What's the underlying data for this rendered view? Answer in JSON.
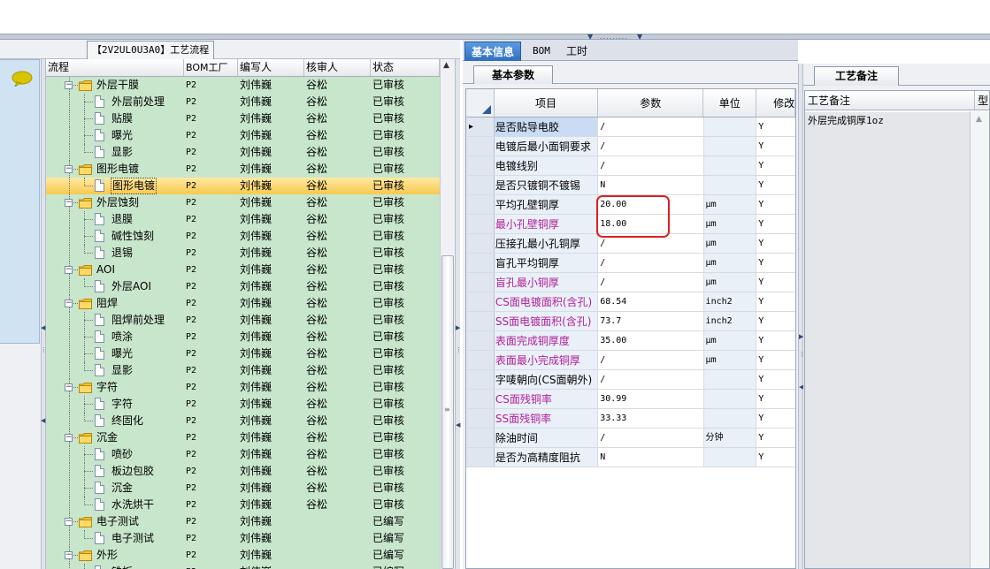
{
  "left": {
    "doc_tab": "【2V2UL0U3A0】工艺流程",
    "columns": [
      "流程",
      "BOM工厂",
      "编写人",
      "核审人",
      "状态"
    ],
    "rows": [
      {
        "level": 0,
        "type": "folder",
        "name": "外层干膜",
        "bom": "P2",
        "author": "刘伟巍",
        "reviewer": "谷松",
        "status": "已审核"
      },
      {
        "level": 1,
        "type": "page",
        "name": "外层前处理",
        "bom": "P2",
        "author": "刘伟巍",
        "reviewer": "谷松",
        "status": "已审核"
      },
      {
        "level": 1,
        "type": "page",
        "name": "贴膜",
        "bom": "P2",
        "author": "刘伟巍",
        "reviewer": "谷松",
        "status": "已审核"
      },
      {
        "level": 1,
        "type": "page",
        "name": "曝光",
        "bom": "P2",
        "author": "刘伟巍",
        "reviewer": "谷松",
        "status": "已审核"
      },
      {
        "level": 1,
        "type": "page",
        "name": "显影",
        "bom": "P2",
        "author": "刘伟巍",
        "reviewer": "谷松",
        "status": "已审核"
      },
      {
        "level": 0,
        "type": "folder",
        "name": "图形电镀",
        "bom": "P2",
        "author": "刘伟巍",
        "reviewer": "谷松",
        "status": "已审核"
      },
      {
        "level": 1,
        "type": "page",
        "name": "图形电镀",
        "bom": "P2",
        "author": "刘伟巍",
        "reviewer": "谷松",
        "status": "已审核",
        "selected": true
      },
      {
        "level": 0,
        "type": "folder",
        "name": "外层蚀刻",
        "bom": "P2",
        "author": "刘伟巍",
        "reviewer": "谷松",
        "status": "已审核"
      },
      {
        "level": 1,
        "type": "page",
        "name": "退膜",
        "bom": "P2",
        "author": "刘伟巍",
        "reviewer": "谷松",
        "status": "已审核"
      },
      {
        "level": 1,
        "type": "page",
        "name": "碱性蚀刻",
        "bom": "P2",
        "author": "刘伟巍",
        "reviewer": "谷松",
        "status": "已审核"
      },
      {
        "level": 1,
        "type": "page",
        "name": "退锡",
        "bom": "P2",
        "author": "刘伟巍",
        "reviewer": "谷松",
        "status": "已审核"
      },
      {
        "level": 0,
        "type": "folder",
        "name": "AOI",
        "bom": "P2",
        "author": "刘伟巍",
        "reviewer": "谷松",
        "status": "已审核"
      },
      {
        "level": 1,
        "type": "page",
        "name": "外层AOI",
        "bom": "P2",
        "author": "刘伟巍",
        "reviewer": "谷松",
        "status": "已审核"
      },
      {
        "level": 0,
        "type": "folder",
        "name": "阻焊",
        "bom": "P2",
        "author": "刘伟巍",
        "reviewer": "谷松",
        "status": "已审核"
      },
      {
        "level": 1,
        "type": "page",
        "name": "阻焊前处理",
        "bom": "P2",
        "author": "刘伟巍",
        "reviewer": "谷松",
        "status": "已审核"
      },
      {
        "level": 1,
        "type": "page",
        "name": "喷涂",
        "bom": "P2",
        "author": "刘伟巍",
        "reviewer": "谷松",
        "status": "已审核"
      },
      {
        "level": 1,
        "type": "page",
        "name": "曝光",
        "bom": "P2",
        "author": "刘伟巍",
        "reviewer": "谷松",
        "status": "已审核"
      },
      {
        "level": 1,
        "type": "page",
        "name": "显影",
        "bom": "P2",
        "author": "刘伟巍",
        "reviewer": "谷松",
        "status": "已审核"
      },
      {
        "level": 0,
        "type": "folder",
        "name": "字符",
        "bom": "P2",
        "author": "刘伟巍",
        "reviewer": "谷松",
        "status": "已审核"
      },
      {
        "level": 1,
        "type": "page",
        "name": "字符",
        "bom": "P2",
        "author": "刘伟巍",
        "reviewer": "谷松",
        "status": "已审核"
      },
      {
        "level": 1,
        "type": "page",
        "name": "终固化",
        "bom": "P2",
        "author": "刘伟巍",
        "reviewer": "谷松",
        "status": "已审核"
      },
      {
        "level": 0,
        "type": "folder",
        "name": "沉金",
        "bom": "P2",
        "author": "刘伟巍",
        "reviewer": "谷松",
        "status": "已审核"
      },
      {
        "level": 1,
        "type": "page",
        "name": "喷砂",
        "bom": "P2",
        "author": "刘伟巍",
        "reviewer": "谷松",
        "status": "已审核"
      },
      {
        "level": 1,
        "type": "page",
        "name": "板边包胶",
        "bom": "P2",
        "author": "刘伟巍",
        "reviewer": "谷松",
        "status": "已审核"
      },
      {
        "level": 1,
        "type": "page",
        "name": "沉金",
        "bom": "P2",
        "author": "刘伟巍",
        "reviewer": "谷松",
        "status": "已审核"
      },
      {
        "level": 1,
        "type": "page",
        "name": "水洗烘干",
        "bom": "P2",
        "author": "刘伟巍",
        "reviewer": "谷松",
        "status": "已审核"
      },
      {
        "level": 0,
        "type": "folder",
        "name": "电子测试",
        "bom": "P2",
        "author": "刘伟巍",
        "reviewer": "",
        "status": "已编写"
      },
      {
        "level": 1,
        "type": "page",
        "name": "电子测试",
        "bom": "P2",
        "author": "刘伟巍",
        "reviewer": "",
        "status": "已编写"
      },
      {
        "level": 0,
        "type": "folder",
        "name": "外形",
        "bom": "P2",
        "author": "刘伟巍",
        "reviewer": "",
        "status": "已编写"
      },
      {
        "level": 1,
        "type": "page",
        "name": "铣板",
        "bom": "P2",
        "author": "刘伟巍",
        "reviewer": "",
        "status": "已编写"
      }
    ]
  },
  "middle": {
    "tabs": [
      "基本信息",
      "BOM",
      "工时"
    ],
    "active_tab": "基本信息",
    "subtab": "基本参数",
    "columns": [
      "项目",
      "参数",
      "单位",
      "修改"
    ],
    "rows": [
      {
        "item": "是否贴导电胶",
        "value": "/",
        "unit": "",
        "mod": "Y",
        "pink": false
      },
      {
        "item": "电镀后最小面铜要求",
        "value": "/",
        "unit": "",
        "mod": "Y",
        "pink": false
      },
      {
        "item": "电镀线别",
        "value": "/",
        "unit": "",
        "mod": "Y",
        "pink": false
      },
      {
        "item": "是否只镀铜不镀锡",
        "value": "N",
        "unit": "",
        "mod": "Y",
        "pink": false
      },
      {
        "item": "平均孔壁铜厚",
        "value": "20.00",
        "unit": "μm",
        "mod": "Y",
        "pink": false
      },
      {
        "item": "最小孔壁铜厚",
        "value": "18.00",
        "unit": "μm",
        "mod": "Y",
        "pink": true
      },
      {
        "item": "压接孔最小孔铜厚",
        "value": "/",
        "unit": "μm",
        "mod": "Y",
        "pink": false
      },
      {
        "item": "盲孔平均铜厚",
        "value": "/",
        "unit": "μm",
        "mod": "Y",
        "pink": false
      },
      {
        "item": "盲孔最小铜厚",
        "value": "/",
        "unit": "μm",
        "mod": "Y",
        "pink": true
      },
      {
        "item": "CS面电镀面积(含孔)",
        "value": "68.54",
        "unit": "inch2",
        "mod": "Y",
        "pink": true
      },
      {
        "item": "SS面电镀面积(含孔)",
        "value": "73.7",
        "unit": "inch2",
        "mod": "Y",
        "pink": true
      },
      {
        "item": "表面完成铜厚度",
        "value": "35.00",
        "unit": "μm",
        "mod": "Y",
        "pink": true
      },
      {
        "item": "表面最小完成铜厚",
        "value": "/",
        "unit": "μm",
        "mod": "Y",
        "pink": true
      },
      {
        "item": "字唛朝向(CS面朝外)",
        "value": "/",
        "unit": "",
        "mod": "Y",
        "pink": false
      },
      {
        "item": "CS面残铜率",
        "value": "30.99",
        "unit": "",
        "mod": "Y",
        "pink": true
      },
      {
        "item": "SS面残铜率",
        "value": "33.33",
        "unit": "",
        "mod": "Y",
        "pink": true
      },
      {
        "item": "除油时间",
        "value": "/",
        "unit": "分钟",
        "mod": "Y",
        "pink": false
      },
      {
        "item": "是否为高精度阻抗",
        "value": "N",
        "unit": "",
        "mod": "Y",
        "pink": false
      }
    ]
  },
  "right": {
    "subtab": "工艺备注",
    "columns": [
      "工艺备注",
      "型"
    ],
    "note": "外层完成铜厚1oz"
  },
  "colors": {
    "tree_bg": "#c8e6cc",
    "selected_row": "#f7c94e",
    "pink_text": "#b0209a",
    "highlight_box": "#e02020",
    "active_tab": "#2f6fc2"
  }
}
